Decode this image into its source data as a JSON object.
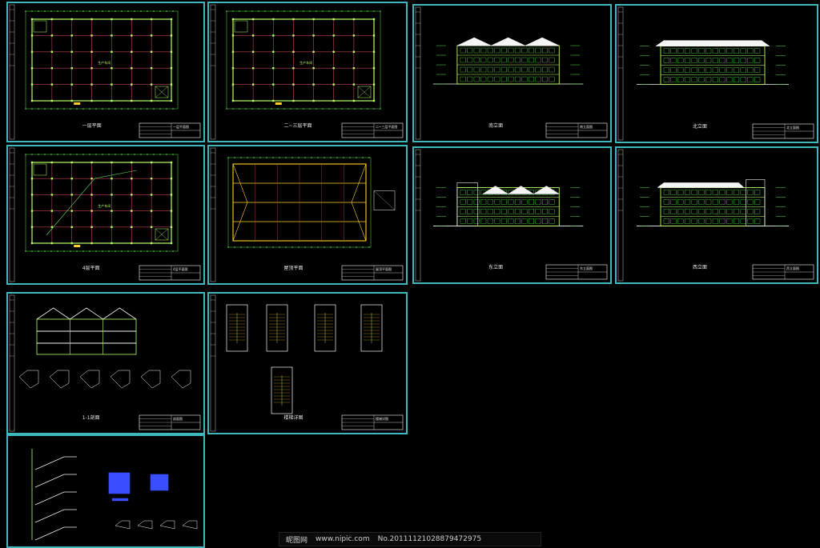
{
  "viewer": {
    "background": "#000000",
    "frame_color": "#3fb7bd",
    "line_colors": {
      "grid": "#c4445a",
      "wall": "#b8ff6a",
      "dim": "#58e04d",
      "roof": "#f5f5f5",
      "accent": "#ffd02a",
      "detail": "#3a4dff",
      "text": "#e8e8e8"
    }
  },
  "sheets": [
    {
      "id": "s1",
      "kind": "plan",
      "label": "一层平面",
      "room_label": "生产车间",
      "tb_label": "一层平面图"
    },
    {
      "id": "s2",
      "kind": "plan",
      "label": "二~三层平面",
      "room_label": "生产车间",
      "tb_label": "二~三层平面图"
    },
    {
      "id": "s3",
      "kind": "elevation-roof3",
      "label": "南立面",
      "tb_label": "南立面图"
    },
    {
      "id": "s4",
      "kind": "elevation-flat",
      "label": "北立面",
      "tb_label": "北立面图"
    },
    {
      "id": "s5",
      "kind": "plan-diag",
      "label": "4层平面",
      "room_label": "生产车间",
      "tb_label": "4层平面图"
    },
    {
      "id": "s6",
      "kind": "roof-plan",
      "label": "屋顶平面",
      "tb_label": "屋顶平面图"
    },
    {
      "id": "s7",
      "kind": "elevation-side",
      "label": "东立面",
      "tb_label": "东立面图"
    },
    {
      "id": "s8",
      "kind": "elevation-stepped",
      "label": "西立面",
      "tb_label": "西立面图"
    },
    {
      "id": "s9",
      "kind": "section",
      "label": "1-1剖面",
      "tb_label": "剖面图"
    },
    {
      "id": "s10",
      "kind": "stairs",
      "label": "楼梯详图",
      "tb_label": "楼梯详图"
    },
    {
      "id": "s11",
      "kind": "stair-section",
      "label": "",
      "tb_label": ""
    }
  ],
  "watermark": {
    "site": "昵图网",
    "url": "www.nipic.com",
    "code": "No.20111121028879472975"
  }
}
